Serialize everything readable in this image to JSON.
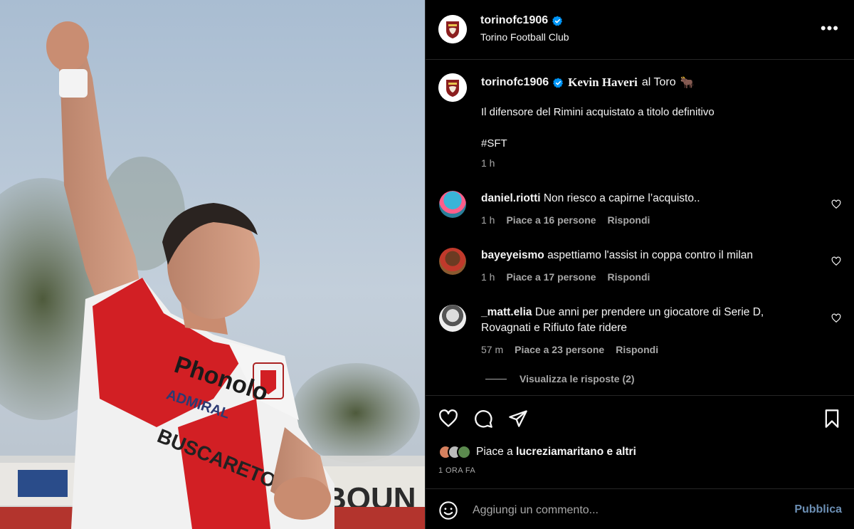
{
  "post": {
    "photo_banner_texts": {
      "sponsor": "Phonolo",
      "sub_sponsor": "ADMIRAL",
      "kit_text": "BUSCARETO",
      "stadium_sign": "BOUN"
    },
    "account": {
      "username": "torinofc1906",
      "full_name": "Torino Football Club",
      "more_label": "•••"
    },
    "caption": {
      "username": "torinofc1906",
      "name_bold": "Kevin Haveri",
      "rest": "al Toro",
      "emoji": "🐂",
      "line2": "Il difensore del Rimini acquistato a titolo definitivo",
      "hashtag": "#SFT",
      "time": "1 h"
    },
    "comments": [
      {
        "username": "daniel.riotti",
        "text": "Non riesco a capirne l’acquisto..",
        "time": "1 h",
        "likes": "Piace a 16 persone",
        "reply": "Rispondi"
      },
      {
        "username": "bayeyeismo",
        "text": "aspettiamo l'assist in coppa contro il milan",
        "time": "1 h",
        "likes": "Piace a 17 persone",
        "reply": "Rispondi"
      },
      {
        "username": "_matt.elia",
        "text": "Due anni per prendere un giocatore di Serie D, Rovagnati e Rifiuto fate ridere",
        "time": "57 m",
        "likes": "Piace a 23 persone",
        "reply": "Rispondi"
      }
    ],
    "view_replies": "Visualizza le risposte (2)",
    "liked_by": {
      "prefix": "Piace a",
      "user": "lucreziamaritano",
      "suffix": "e altri"
    },
    "posted_ago": "1 ORA FA",
    "composer": {
      "placeholder": "Aggiungi un commento...",
      "publish_label": "Pubblica"
    },
    "colors": {
      "background": "#000000",
      "divider": "#262626",
      "muted": "#a8a8a8",
      "verified": "#0095f6",
      "publish": "#6c8fb4"
    },
    "icons": [
      "torino-logo-icon",
      "verified-icon",
      "more-icon",
      "heart-icon",
      "comment-icon",
      "share-icon",
      "bookmark-icon",
      "emoji-icon"
    ]
  }
}
